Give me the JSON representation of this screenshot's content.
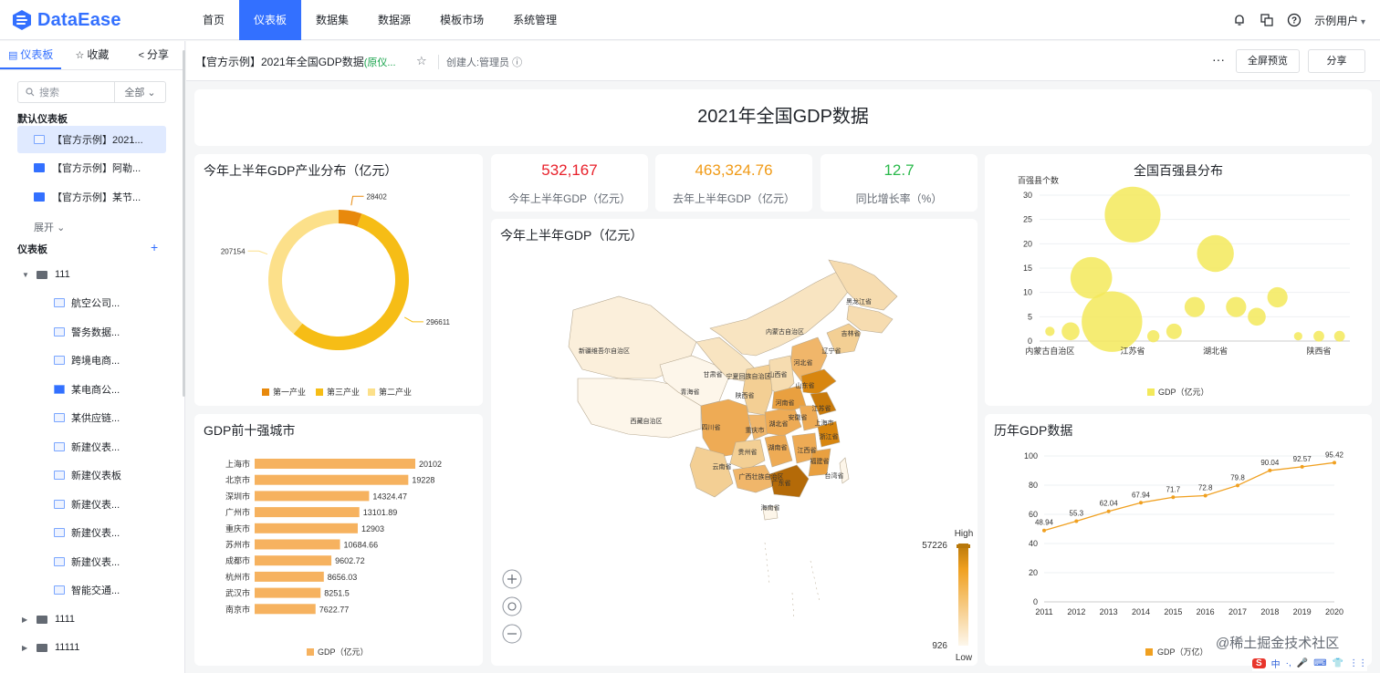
{
  "app": {
    "logo_text": "DataEase"
  },
  "nav": [
    {
      "label": "首页",
      "active": false
    },
    {
      "label": "仪表板",
      "active": true
    },
    {
      "label": "数据集",
      "active": false
    },
    {
      "label": "数据源",
      "active": false
    },
    {
      "label": "模板市场",
      "active": false
    },
    {
      "label": "系统管理",
      "active": false
    }
  ],
  "user": {
    "name": "示例用户"
  },
  "sidebar": {
    "tabs": {
      "dashboard": "仪表板",
      "favorite": "收藏",
      "share": "分享"
    },
    "search_placeholder": "搜索",
    "filter_value": "全部",
    "default_section": "默认仪表板",
    "default_items": [
      "【官方示例】2021...",
      "【官方示例】阿勒...",
      "【官方示例】某节..."
    ],
    "expand_label": "展开",
    "section": "仪表板",
    "folder_111": "111",
    "leaves": [
      "航空公司...",
      "警务数据...",
      "跨境电商...",
      "某电商公...",
      "某供应链...",
      "新建仪表...",
      "新建仪表板",
      "新建仪表...",
      "新建仪表...",
      "新建仪表...",
      "智能交通..."
    ],
    "folder_1111": "1111",
    "folder_11111": "11111"
  },
  "header": {
    "title": "【官方示例】2021年全国GDP数据",
    "title_tag": "(原仪...",
    "creator": "创建人:管理员",
    "more": "···",
    "preview_button": "全屏预览",
    "share_button": "分享"
  },
  "dashboard": {
    "main_title": "2021年全国GDP数据",
    "kpis": [
      {
        "value": "532,167",
        "label": "今年上半年GDP（亿元）",
        "color": "#e8202a"
      },
      {
        "value": "463,324.76",
        "label": "去年上半年GDP（亿元）",
        "color": "#f09a16"
      },
      {
        "value": "12.7",
        "label": "同比增长率（%）",
        "color": "#29b94a"
      }
    ],
    "map": {
      "title": "今年上半年GDP（亿元）",
      "legend_high": "High",
      "legend_low": "Low",
      "legend_max": "57226",
      "legend_min": "926",
      "labels": [
        "新疆维吾尔自治区",
        "西藏自治区",
        "青海省",
        "甘肃省",
        "内蒙古自治区",
        "黑龙江省",
        "吉林省",
        "辽宁省",
        "四川省",
        "重庆市",
        "云南省",
        "贵州省",
        "广西壮族自治区",
        "广东省",
        "海南省",
        "湖南省",
        "湖北省",
        "河南省",
        "山东省",
        "江苏省",
        "上海市",
        "浙江省",
        "福建省",
        "台湾省",
        "江西省",
        "安徽省",
        "陕西省",
        "山西省",
        "宁夏回族自治区",
        "河北省"
      ]
    },
    "watermark": "@稀土掘金技术社区",
    "ime": {
      "s": "S",
      "items": [
        "中",
        "·,",
        "🎤",
        "⌨",
        "👕",
        "⋮⋮"
      ]
    }
  },
  "chart_data": [
    {
      "type": "pie",
      "title": "今年上半年GDP产业分布（亿元）",
      "categories": [
        "第一产业",
        "第三产业",
        "第二产业"
      ],
      "values": [
        28402,
        296611,
        207154
      ],
      "colors": [
        "#e8890c",
        "#f6bd16",
        "#fce08a"
      ],
      "legend": "bottom"
    },
    {
      "type": "bar",
      "title": "GDP前十强城市",
      "categories": [
        "上海市",
        "北京市",
        "深圳市",
        "广州市",
        "重庆市",
        "苏州市",
        "成都市",
        "杭州市",
        "武汉市",
        "南京市"
      ],
      "values": [
        20102,
        19228,
        14324.47,
        13101.89,
        12903,
        10684.66,
        9602.72,
        8656.03,
        8251.5,
        7622.77
      ],
      "series": [
        {
          "name": "GDP（亿元）",
          "values": [
            20102,
            19228,
            14324.47,
            13101.89,
            12903,
            10684.66,
            9602.72,
            8656.03,
            8251.5,
            7622.77
          ]
        }
      ],
      "color": "#f6b25f",
      "legend": "bottom"
    },
    {
      "type": "scatter",
      "title": "全国百强县分布",
      "ylabel": "百强县个数",
      "yticks": [
        0,
        5,
        10,
        15,
        20,
        25,
        30
      ],
      "xticks": [
        "内蒙古自治区",
        "江苏省",
        "湖北省",
        "陕西省"
      ],
      "ylim": [
        0,
        30
      ],
      "points": [
        {
          "x": 0,
          "y": 2,
          "size": 1.2
        },
        {
          "x": 1,
          "y": 2,
          "size": 3
        },
        {
          "x": 2,
          "y": 13,
          "size": 8
        },
        {
          "x": 3,
          "y": 4,
          "size": 12
        },
        {
          "x": 4,
          "y": 26,
          "size": 11
        },
        {
          "x": 5,
          "y": 1,
          "size": 1.8
        },
        {
          "x": 6,
          "y": 2,
          "size": 2.5
        },
        {
          "x": 7,
          "y": 7,
          "size": 3.5
        },
        {
          "x": 8,
          "y": 18,
          "size": 7
        },
        {
          "x": 9,
          "y": 7,
          "size": 3.5
        },
        {
          "x": 10,
          "y": 5,
          "size": 3
        },
        {
          "x": 11,
          "y": 9,
          "size": 3.5
        },
        {
          "x": 12,
          "y": 1,
          "size": 1
        },
        {
          "x": 13,
          "y": 1,
          "size": 1.5
        },
        {
          "x": 14,
          "y": 1,
          "size": 1.5
        }
      ],
      "series": [
        {
          "name": "GDP（亿元）"
        }
      ],
      "color": "#f3e95b",
      "legend": "bottom"
    },
    {
      "type": "line",
      "title": "历年GDP数据",
      "x": [
        "2011",
        "2012",
        "2013",
        "2014",
        "2015",
        "2016",
        "2017",
        "2018",
        "2019",
        "2020"
      ],
      "values": [
        48.94,
        55.3,
        62.04,
        67.94,
        71.7,
        72.8,
        79.8,
        90.04,
        92.57,
        95.42
      ],
      "series": [
        {
          "name": "GDP（万亿）",
          "values": [
            48.94,
            55.3,
            62.04,
            67.94,
            71.7,
            72.8,
            79.8,
            90.04,
            92.57,
            95.42
          ]
        }
      ],
      "yticks": [
        0,
        20,
        40,
        60,
        80,
        100
      ],
      "ylim": [
        0,
        100
      ],
      "color": "#f0a020",
      "legend": "bottom"
    }
  ]
}
